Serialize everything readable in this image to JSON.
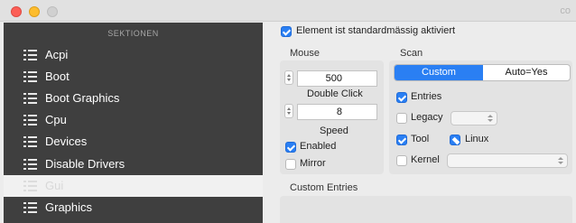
{
  "window": {
    "title": "co"
  },
  "sidebar": {
    "header": "SEKTIONEN",
    "items": [
      {
        "label": "Acpi"
      },
      {
        "label": "Boot"
      },
      {
        "label": "Boot Graphics"
      },
      {
        "label": "Cpu"
      },
      {
        "label": "Devices"
      },
      {
        "label": "Disable Drivers"
      },
      {
        "label": "Gui",
        "selected": true
      },
      {
        "label": "Graphics"
      }
    ]
  },
  "content": {
    "enabled_by_default": {
      "label": "Element ist standardmässig aktiviert",
      "checked": true
    },
    "mouse": {
      "title": "Mouse",
      "double_click": {
        "value": "500",
        "label": "Double Click"
      },
      "speed": {
        "value": "8",
        "label": "Speed"
      },
      "enabled": {
        "label": "Enabled",
        "checked": true
      },
      "mirror": {
        "label": "Mirror",
        "checked": false
      }
    },
    "scan": {
      "title": "Scan",
      "mode_options": [
        "Custom",
        "Auto=Yes"
      ],
      "selected_mode": "Custom",
      "entries": {
        "label": "Entries",
        "checked": true
      },
      "legacy": {
        "label": "Legacy",
        "checked": false,
        "value": ""
      },
      "tool": {
        "label": "Tool",
        "checked": true
      },
      "linux": {
        "label": "Linux",
        "state": "mixed"
      },
      "kernel": {
        "label": "Kernel",
        "checked": false,
        "value": ""
      }
    },
    "custom_entries": {
      "title": "Custom Entries"
    }
  },
  "colors": {
    "accent": "#2a7ff3",
    "sidebar_bg": "#3f3f3f",
    "sidebar_selected": "#f1f1f1",
    "content_bg": "#ececec",
    "group_box": "#e3e3e3"
  },
  "icons": {
    "traffic_lights": [
      "close-button",
      "minimize-button",
      "zoom-button"
    ],
    "sidebar_item_icon": "list-icon"
  }
}
